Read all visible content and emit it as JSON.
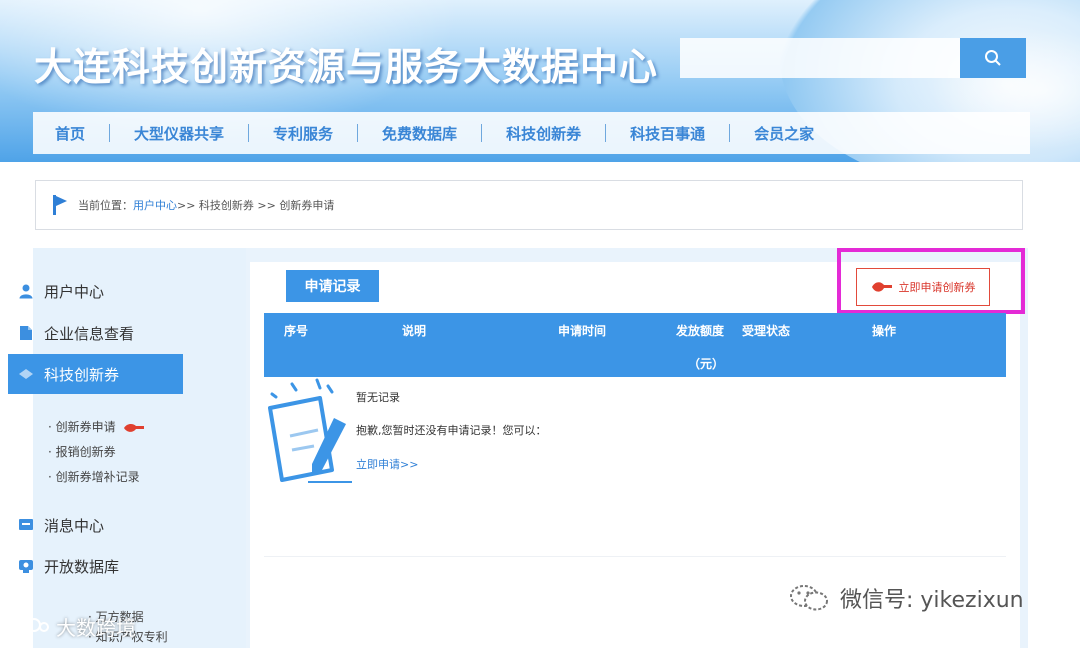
{
  "header": {
    "site_title": "大连科技创新资源与服务大数据中心",
    "search_placeholder": "",
    "search_icon": "search-icon"
  },
  "nav": {
    "items": [
      "首页",
      "大型仪器共享",
      "专利服务",
      "免费数据库",
      "科技创新券",
      "科技百事通",
      "会员之家"
    ]
  },
  "breadcrumb": {
    "prefix": "当前位置：",
    "link": "用户中心",
    "rest": " >> 科技创新券 >> 创新券申请"
  },
  "sidebar": {
    "items": [
      {
        "label": "用户中心",
        "icon": "user-icon"
      },
      {
        "label": "企业信息查看",
        "icon": "document-icon"
      },
      {
        "label": "科技创新券",
        "icon": "coupon-icon",
        "active": true
      },
      {
        "label": "消息中心",
        "icon": "message-icon"
      },
      {
        "label": "开放数据库",
        "icon": "database-icon"
      }
    ],
    "sub_items": [
      "· 创新券申请",
      "· 报销创新券",
      "· 创新券增补记录"
    ],
    "cut_items": [
      "· 万方数据",
      "· 知识产权专利"
    ]
  },
  "main": {
    "tab_label": "申请记录",
    "apply_button": "立即申请创新券",
    "table_headers": [
      "序号",
      "说明",
      "申请时间",
      "发放额度",
      "受理状态",
      "操作"
    ],
    "amount_unit": "（元）",
    "empty_title": "暂无记录",
    "empty_message": "抱歉,您暂时还没有申请记录！您可以：",
    "empty_link": "立即申请>>"
  },
  "watermarks": {
    "wechat": "微信号: yikezixun",
    "bottom": "大数跨境"
  },
  "colors": {
    "accent": "#3c95e6",
    "highlight": "#e42ad6",
    "apply_red": "#d9362b"
  }
}
